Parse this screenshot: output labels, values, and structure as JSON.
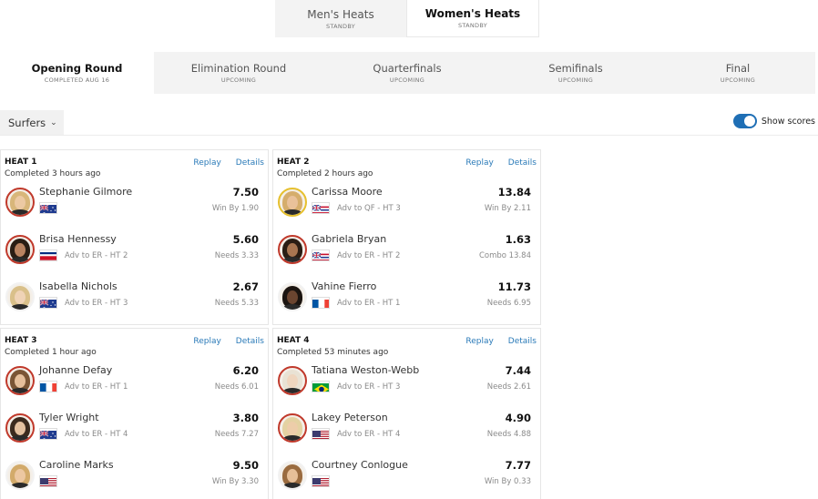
{
  "gender_tabs": [
    {
      "label": "Men's Heats",
      "sub": "STANDBY"
    },
    {
      "label": "Women's Heats",
      "sub": "STANDBY"
    }
  ],
  "round_tabs": [
    {
      "label": "Opening Round",
      "sub": "COMPLETED AUG 16"
    },
    {
      "label": "Elimination Round",
      "sub": "UPCOMING"
    },
    {
      "label": "Quarterfinals",
      "sub": "UPCOMING"
    },
    {
      "label": "Semifinals",
      "sub": "UPCOMING"
    },
    {
      "label": "Final",
      "sub": "UPCOMING"
    }
  ],
  "filter": {
    "surfers_label": "Surfers",
    "show_scores_label": "Show scores"
  },
  "actions": {
    "replay": "Replay",
    "details": "Details"
  },
  "heats": [
    {
      "title": "HEAT 1",
      "status": "Completed 3 hours ago",
      "surfers": [
        {
          "name": "Stephanie Gilmore",
          "flag": "AUS",
          "status": "",
          "score": "7.50",
          "note": "Win By 1.90"
        },
        {
          "name": "Brisa Hennessy",
          "flag": "CRC",
          "status": "Adv to ER - HT 2",
          "score": "5.60",
          "note": "Needs 3.33"
        },
        {
          "name": "Isabella Nichols",
          "flag": "AUS",
          "status": "Adv to ER - HT 3",
          "score": "2.67",
          "note": "Needs 5.33"
        }
      ]
    },
    {
      "title": "HEAT 2",
      "status": "Completed 2 hours ago",
      "surfers": [
        {
          "name": "Carissa Moore",
          "flag": "HAW",
          "status": "Adv to QF - HT 3",
          "score": "13.84",
          "note": "Win By 2.11"
        },
        {
          "name": "Gabriela Bryan",
          "flag": "HAW",
          "status": "Adv to ER - HT 2",
          "score": "1.63",
          "note": "Combo 13.84"
        },
        {
          "name": "Vahine Fierro",
          "flag": "FRA",
          "status": "Adv to ER - HT 1",
          "score": "11.73",
          "note": "Needs 6.95"
        }
      ]
    },
    {
      "title": "HEAT 3",
      "status": "Completed 1 hour ago",
      "surfers": [
        {
          "name": "Johanne Defay",
          "flag": "FRA",
          "status": "Adv to ER - HT 1",
          "score": "6.20",
          "note": "Needs 6.01"
        },
        {
          "name": "Tyler Wright",
          "flag": "AUS",
          "status": "Adv to ER - HT 4",
          "score": "3.80",
          "note": "Needs 7.27"
        },
        {
          "name": "Caroline Marks",
          "flag": "USA",
          "status": "",
          "score": "9.50",
          "note": "Win By 3.30"
        }
      ]
    },
    {
      "title": "HEAT 4",
      "status": "Completed 53 minutes ago",
      "surfers": [
        {
          "name": "Tatiana Weston-Webb",
          "flag": "BRA",
          "status": "Adv to ER - HT 3",
          "score": "7.44",
          "note": "Needs 2.61"
        },
        {
          "name": "Lakey Peterson",
          "flag": "USA",
          "status": "Adv to ER - HT 4",
          "score": "4.90",
          "note": "Needs 4.88"
        },
        {
          "name": "Courtney Conlogue",
          "flag": "USA",
          "status": "",
          "score": "7.77",
          "note": "Win By 0.33"
        }
      ]
    }
  ],
  "colors": {
    "accent": "#2a7ab8",
    "toggle": "#1f6fb5",
    "leader_ring": "#c0392b",
    "winner_ring": "#e6c02e"
  }
}
